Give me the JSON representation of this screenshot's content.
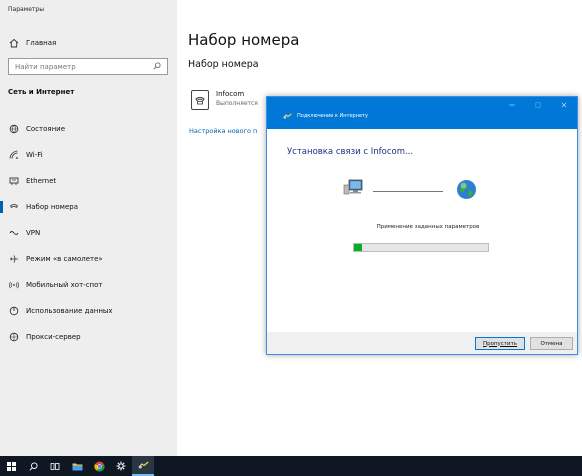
{
  "window": {
    "title": "Параметры"
  },
  "sidebar": {
    "home_label": "Главная",
    "search_placeholder": "Найти параметр",
    "section_title": "Сеть и Интернет",
    "items": [
      {
        "label": "Состояние",
        "icon": "globe-status-icon"
      },
      {
        "label": "Wi-Fi",
        "icon": "wifi-icon"
      },
      {
        "label": "Ethernet",
        "icon": "ethernet-icon"
      },
      {
        "label": "Набор номера",
        "icon": "dialup-icon",
        "active": true
      },
      {
        "label": "VPN",
        "icon": "vpn-icon"
      },
      {
        "label": "Режим «в самолете»",
        "icon": "airplane-icon"
      },
      {
        "label": "Мобильный хот-спот",
        "icon": "hotspot-icon"
      },
      {
        "label": "Использование данных",
        "icon": "data-usage-icon"
      },
      {
        "label": "Прокси-сервер",
        "icon": "proxy-globe-icon"
      }
    ]
  },
  "main": {
    "title": "Набор номера",
    "subheading": "Набор номера",
    "connection": {
      "name": "Infocom",
      "status": "Выполняется"
    },
    "setup_link": "Настройка нового п"
  },
  "dialog": {
    "title": "Подключение к Интернету",
    "heading": "Установка связи с Infocom...",
    "status": "Применение заданных параметров",
    "progress_fraction": 0.06,
    "skip_label": "Пропустить",
    "cancel_label": "Отмена"
  },
  "taskbar": {
    "items": [
      "start-icon",
      "search-icon",
      "task-view-icon",
      "file-explorer-icon",
      "chrome-icon",
      "settings-icon",
      "network-wizard-icon"
    ]
  },
  "colors": {
    "accent": "#0078d7",
    "link": "#0063b1",
    "progress": "#06b025",
    "taskbar": "#0f1722"
  }
}
